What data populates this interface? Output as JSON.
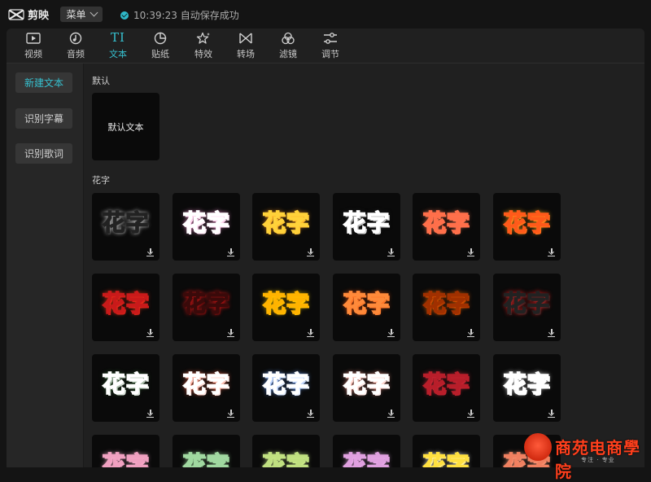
{
  "app": {
    "name": "剪映"
  },
  "topbar": {
    "menu_label": "菜单",
    "status_text": "10:39:23 自动保存成功"
  },
  "tabs": [
    {
      "label": "视频",
      "icon": "video-icon"
    },
    {
      "label": "音频",
      "icon": "audio-icon"
    },
    {
      "label": "文本",
      "icon": "text-icon",
      "glyph": "TI",
      "active": true
    },
    {
      "label": "贴纸",
      "icon": "sticker-icon"
    },
    {
      "label": "特效",
      "icon": "effects-icon"
    },
    {
      "label": "转场",
      "icon": "transition-icon"
    },
    {
      "label": "滤镜",
      "icon": "filter-icon"
    },
    {
      "label": "调节",
      "icon": "adjust-icon"
    }
  ],
  "sidebar": {
    "items": [
      {
        "label": "新建文本",
        "active": true
      },
      {
        "label": "识别字幕"
      },
      {
        "label": "识别歌词"
      }
    ]
  },
  "sections": {
    "default": {
      "title": "默认",
      "card_label": "默认文本"
    },
    "huazi": {
      "title": "花字",
      "card_text": "花字",
      "styles": [
        {
          "fill": "#ffffff",
          "stroke": "#222222",
          "glow": "#ffffff"
        },
        {
          "fill": "#f3c6e8",
          "stroke": "#ffffff",
          "glow": "#ff9ad8"
        },
        {
          "fill": "#ff3a1a",
          "stroke": "#ffd23a",
          "glow": "#ff9a20"
        },
        {
          "fill": "#e31e1e",
          "stroke": "#ffffff",
          "glow": "#222222"
        },
        {
          "fill": "#ffffff",
          "stroke": "#ff6f4a",
          "glow": "#ff7a55"
        },
        {
          "fill": "#ffffff",
          "stroke": "#ff5a1a",
          "glow": "#ffb020"
        },
        {
          "fill": "#ffe33a",
          "stroke": "#c91a1a",
          "glow": "#ff3a1a"
        },
        {
          "fill": "#ff2a1a",
          "stroke": "#3a0a0a",
          "glow": "#ff1a1a"
        },
        {
          "fill": "#ffe820",
          "stroke": "#ffb300",
          "glow": "#ffd000"
        },
        {
          "fill": "#ff5020",
          "stroke": "#ff8a3a",
          "glow": "#ff5a10"
        },
        {
          "fill": "#ff6a1a",
          "stroke": "#a03000",
          "glow": "#ff6a00"
        },
        {
          "fill": "#d41010",
          "stroke": "#222222",
          "glow": "#ff2020"
        },
        {
          "fill": "#4a8a3a",
          "stroke": "#ffffff",
          "glow": "#2a5a2a"
        },
        {
          "fill": "#e84a2a",
          "stroke": "#ffffff",
          "glow": "#ff6a4a"
        },
        {
          "fill": "#9ec4ff",
          "stroke": "#ffffff",
          "glow": "#6aa0ff"
        },
        {
          "fill": "#f08a7a",
          "stroke": "#ffffff",
          "glow": "#ff9a8a"
        },
        {
          "fill": "#f4e0e0",
          "stroke": "#b81e2a",
          "glow": "#d02a3a"
        },
        {
          "fill": "#2a5a3a",
          "stroke": "#ffffff",
          "glow": "#ffffff"
        },
        {
          "fill": "#ffffff",
          "stroke": "#f0a0c0",
          "glow": "#ffb0d0"
        },
        {
          "fill": "#ffffff",
          "stroke": "#a0d8a0",
          "glow": "#a0e0a0"
        },
        {
          "fill": "#e8ffd0",
          "stroke": "#c0e080",
          "glow": "#d0f090"
        },
        {
          "fill": "#ffffff",
          "stroke": "#e0a0e0",
          "glow": "#f0b0f0"
        },
        {
          "fill": "#c090ff",
          "stroke": "#ffe040",
          "glow": "#ffffff"
        },
        {
          "fill": "#ffffff",
          "stroke": "#f08060",
          "glow": "#ffa080"
        }
      ]
    }
  },
  "watermark": {
    "text": "商苑电商學院",
    "subtext": "专注 · 专业"
  }
}
